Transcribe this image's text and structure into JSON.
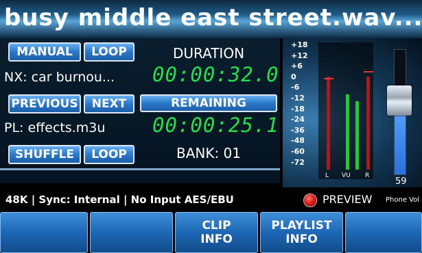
{
  "title": "busy middle east street.wav...",
  "left": {
    "manual_label": "MANUAL",
    "loop_label_top": "LOOP",
    "next_item_text": "NX: car burnou...",
    "previous_label": "PREVIOUS",
    "next_label": "NEXT",
    "playlist_text": "PL:  effects.m3u",
    "shuffle_label": "SHUFFLE",
    "loop_label_bottom": "LOOP"
  },
  "center": {
    "duration_label": "DURATION",
    "duration_value": "00:00:32.0",
    "remaining_label": "REMAINING",
    "remaining_value": "00:00:25.1",
    "bank_label": "BANK: 01"
  },
  "meter": {
    "scale": [
      "+18",
      "+12",
      "+6",
      "0",
      "-6",
      "-12",
      "-18",
      "-24",
      "-36",
      "-48",
      "-60",
      "-72"
    ],
    "channel_labels": [
      "L",
      "VU",
      "R"
    ],
    "levels": {
      "L": 0.0,
      "VU_1": 0.65,
      "VU_2": 0.59,
      "R": 0.0
    },
    "peaks": {
      "L": 0.88,
      "R": 0.95
    },
    "colors": {
      "active": "#1ecc2e",
      "inactive": "#b01818",
      "peak": "#e03a3a"
    }
  },
  "fader": {
    "value": "59",
    "level": 0.59
  },
  "status": {
    "text": "48K | Sync: Internal | No Input AES/EBU",
    "preview_label": "PREVIEW",
    "phone_vol_label": "Phone Vol"
  },
  "softkeys": [
    {
      "line1": "",
      "line2": ""
    },
    {
      "line1": "",
      "line2": ""
    },
    {
      "line1": "CLIP",
      "line2": "INFO"
    },
    {
      "line1": "PLAYLIST",
      "line2": "INFO"
    },
    {
      "line1": "",
      "line2": ""
    }
  ]
}
